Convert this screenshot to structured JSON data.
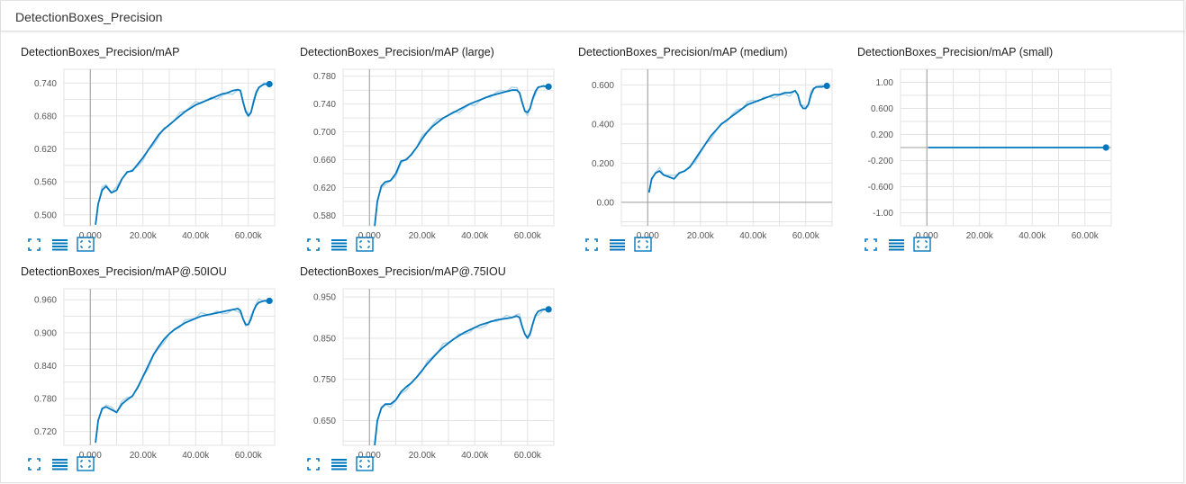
{
  "group": {
    "title": "DetectionBoxes_Precision"
  },
  "colors": {
    "accent": "#0277bd",
    "raw": "#b3d5ea",
    "grid": "#e3e3e3",
    "axis": "#9e9e9e"
  },
  "toolbar_icons": [
    "expand-icon",
    "toggle-log-scale-icon",
    "fit-domain-icon"
  ],
  "chart_data": [
    {
      "type": "line",
      "title": "DetectionBoxes_Precision/mAP",
      "xlim": [
        -10000,
        70000
      ],
      "ylim": [
        0.48,
        0.765
      ],
      "xticks": [
        0,
        20000,
        40000,
        60000
      ],
      "xtick_labels": [
        "0.000",
        "20.00k",
        "40.00k",
        "60.00k"
      ],
      "yticks": [
        0.5,
        0.56,
        0.62,
        0.68,
        0.74
      ],
      "ytick_labels": [
        "0.500",
        "0.560",
        "0.620",
        "0.680",
        "0.740"
      ],
      "grid": true,
      "series": [
        {
          "x": [
            2000,
            3000,
            4500,
            6000,
            8000,
            10000,
            12000,
            14000,
            16000,
            18000,
            20000,
            22000,
            24000,
            26000,
            28000,
            30000,
            32000,
            34000,
            36000,
            38000,
            40000,
            42000,
            44000,
            46000,
            48000,
            50000,
            52000,
            54000,
            56000,
            57000,
            58000,
            59000,
            60000,
            61000,
            62000,
            63000,
            64000,
            66000,
            68000
          ],
          "y": [
            0.482,
            0.52,
            0.545,
            0.552,
            0.54,
            0.545,
            0.565,
            0.578,
            0.58,
            0.592,
            0.604,
            0.618,
            0.632,
            0.646,
            0.656,
            0.664,
            0.672,
            0.68,
            0.688,
            0.694,
            0.7,
            0.704,
            0.708,
            0.712,
            0.716,
            0.72,
            0.722,
            0.726,
            0.728,
            0.726,
            0.706,
            0.688,
            0.68,
            0.686,
            0.705,
            0.722,
            0.732,
            0.738,
            0.738
          ]
        }
      ]
    },
    {
      "type": "line",
      "title": "DetectionBoxes_Precision/mAP (large)",
      "xlim": [
        -10000,
        70000
      ],
      "ylim": [
        0.565,
        0.79
      ],
      "xticks": [
        0,
        20000,
        40000,
        60000
      ],
      "xtick_labels": [
        "0.000",
        "20.00k",
        "40.00k",
        "60.00k"
      ],
      "yticks": [
        0.58,
        0.62,
        0.66,
        0.7,
        0.74,
        0.78
      ],
      "ytick_labels": [
        "0.580",
        "0.620",
        "0.660",
        "0.700",
        "0.740",
        "0.780"
      ],
      "grid": true,
      "series": [
        {
          "x": [
            2000,
            3000,
            4500,
            6000,
            8000,
            10000,
            12000,
            14000,
            16000,
            18000,
            20000,
            22000,
            24000,
            26000,
            28000,
            30000,
            32000,
            34000,
            36000,
            38000,
            40000,
            42000,
            44000,
            46000,
            48000,
            50000,
            52000,
            54000,
            56000,
            57000,
            58000,
            59000,
            60000,
            61000,
            62000,
            63000,
            64000,
            66000,
            68000
          ],
          "y": [
            0.565,
            0.6,
            0.622,
            0.628,
            0.63,
            0.64,
            0.658,
            0.66,
            0.668,
            0.678,
            0.69,
            0.7,
            0.708,
            0.714,
            0.72,
            0.724,
            0.728,
            0.732,
            0.736,
            0.74,
            0.743,
            0.746,
            0.749,
            0.752,
            0.754,
            0.756,
            0.758,
            0.76,
            0.76,
            0.756,
            0.742,
            0.73,
            0.728,
            0.734,
            0.748,
            0.758,
            0.764,
            0.766,
            0.765
          ]
        }
      ]
    },
    {
      "type": "line",
      "title": "DetectionBoxes_Precision/mAP (medium)",
      "xlim": [
        -10000,
        70000
      ],
      "ylim": [
        -0.12,
        0.68
      ],
      "xticks": [
        0,
        20000,
        40000,
        60000
      ],
      "xtick_labels": [
        "0.000",
        "20.00k",
        "40.00k",
        "60.00k"
      ],
      "yticks": [
        0.0,
        0.2,
        0.4,
        0.6
      ],
      "ytick_labels": [
        "0.00",
        "0.200",
        "0.400",
        "0.600"
      ],
      "grid": true,
      "series": [
        {
          "x": [
            500,
            1500,
            3000,
            4500,
            6000,
            8000,
            10000,
            12000,
            14000,
            16000,
            18000,
            20000,
            22000,
            24000,
            26000,
            28000,
            30000,
            32000,
            34000,
            36000,
            38000,
            40000,
            42000,
            44000,
            46000,
            48000,
            50000,
            52000,
            54000,
            56000,
            57000,
            58000,
            59000,
            60000,
            61000,
            62000,
            63000,
            64000,
            66000,
            68000
          ],
          "y": [
            0.05,
            0.12,
            0.15,
            0.16,
            0.14,
            0.13,
            0.12,
            0.15,
            0.16,
            0.18,
            0.22,
            0.26,
            0.3,
            0.34,
            0.37,
            0.4,
            0.42,
            0.44,
            0.46,
            0.48,
            0.5,
            0.51,
            0.52,
            0.53,
            0.54,
            0.55,
            0.55,
            0.56,
            0.56,
            0.57,
            0.55,
            0.5,
            0.48,
            0.48,
            0.5,
            0.55,
            0.58,
            0.59,
            0.59,
            0.595
          ]
        }
      ]
    },
    {
      "type": "line",
      "title": "DetectionBoxes_Precision/mAP (small)",
      "xlim": [
        -10000,
        70000
      ],
      "ylim": [
        -1.2,
        1.2
      ],
      "xticks": [
        0,
        20000,
        40000,
        60000
      ],
      "xtick_labels": [
        "0.000",
        "20.00k",
        "40.00k",
        "60.00k"
      ],
      "yticks": [
        -1.0,
        -0.6,
        -0.2,
        0.2,
        0.6,
        1.0
      ],
      "ytick_labels": [
        "-1.00",
        "-0.600",
        "-0.200",
        "0.200",
        "0.600",
        "1.00"
      ],
      "grid": true,
      "series": [
        {
          "x": [
            500,
            68000
          ],
          "y": [
            0.0,
            0.0
          ]
        }
      ]
    },
    {
      "type": "line",
      "title": "DetectionBoxes_Precision/mAP@.50IOU",
      "xlim": [
        -10000,
        70000
      ],
      "ylim": [
        0.695,
        0.98
      ],
      "xticks": [
        0,
        20000,
        40000,
        60000
      ],
      "xtick_labels": [
        "0.000",
        "20.00k",
        "40.00k",
        "60.00k"
      ],
      "yticks": [
        0.72,
        0.78,
        0.84,
        0.9,
        0.96
      ],
      "ytick_labels": [
        "0.720",
        "0.780",
        "0.840",
        "0.900",
        "0.960"
      ],
      "grid": true,
      "series": [
        {
          "x": [
            2000,
            3000,
            4500,
            6000,
            8000,
            10000,
            12000,
            14000,
            16000,
            18000,
            20000,
            22000,
            24000,
            26000,
            28000,
            30000,
            32000,
            34000,
            36000,
            38000,
            40000,
            42000,
            44000,
            46000,
            48000,
            50000,
            52000,
            54000,
            56000,
            57000,
            58000,
            59000,
            60000,
            61000,
            62000,
            63000,
            64000,
            66000,
            68000
          ],
          "y": [
            0.7,
            0.74,
            0.762,
            0.765,
            0.76,
            0.755,
            0.77,
            0.778,
            0.785,
            0.8,
            0.82,
            0.84,
            0.86,
            0.875,
            0.888,
            0.898,
            0.906,
            0.912,
            0.918,
            0.922,
            0.926,
            0.93,
            0.932,
            0.934,
            0.936,
            0.938,
            0.94,
            0.942,
            0.944,
            0.94,
            0.925,
            0.915,
            0.915,
            0.925,
            0.94,
            0.95,
            0.955,
            0.958,
            0.958
          ]
        }
      ]
    },
    {
      "type": "line",
      "title": "DetectionBoxes_Precision/mAP@.75IOU",
      "xlim": [
        -10000,
        70000
      ],
      "ylim": [
        0.59,
        0.97
      ],
      "xticks": [
        0,
        20000,
        40000,
        60000
      ],
      "xtick_labels": [
        "0.000",
        "20.00k",
        "40.00k",
        "60.00k"
      ],
      "yticks": [
        0.65,
        0.75,
        0.85,
        0.95
      ],
      "ytick_labels": [
        "0.650",
        "0.750",
        "0.850",
        "0.950"
      ],
      "grid": true,
      "series": [
        {
          "x": [
            2000,
            3000,
            4500,
            6000,
            8000,
            10000,
            12000,
            14000,
            16000,
            18000,
            20000,
            22000,
            24000,
            26000,
            28000,
            30000,
            32000,
            34000,
            36000,
            38000,
            40000,
            42000,
            44000,
            46000,
            48000,
            50000,
            52000,
            54000,
            56000,
            57000,
            58000,
            59000,
            60000,
            61000,
            62000,
            63000,
            64000,
            66000,
            68000
          ],
          "y": [
            0.59,
            0.65,
            0.68,
            0.69,
            0.69,
            0.7,
            0.72,
            0.732,
            0.742,
            0.756,
            0.772,
            0.788,
            0.802,
            0.816,
            0.828,
            0.838,
            0.848,
            0.856,
            0.864,
            0.87,
            0.876,
            0.882,
            0.886,
            0.89,
            0.894,
            0.896,
            0.898,
            0.9,
            0.904,
            0.9,
            0.878,
            0.86,
            0.85,
            0.862,
            0.885,
            0.905,
            0.915,
            0.92,
            0.92
          ]
        }
      ]
    }
  ]
}
